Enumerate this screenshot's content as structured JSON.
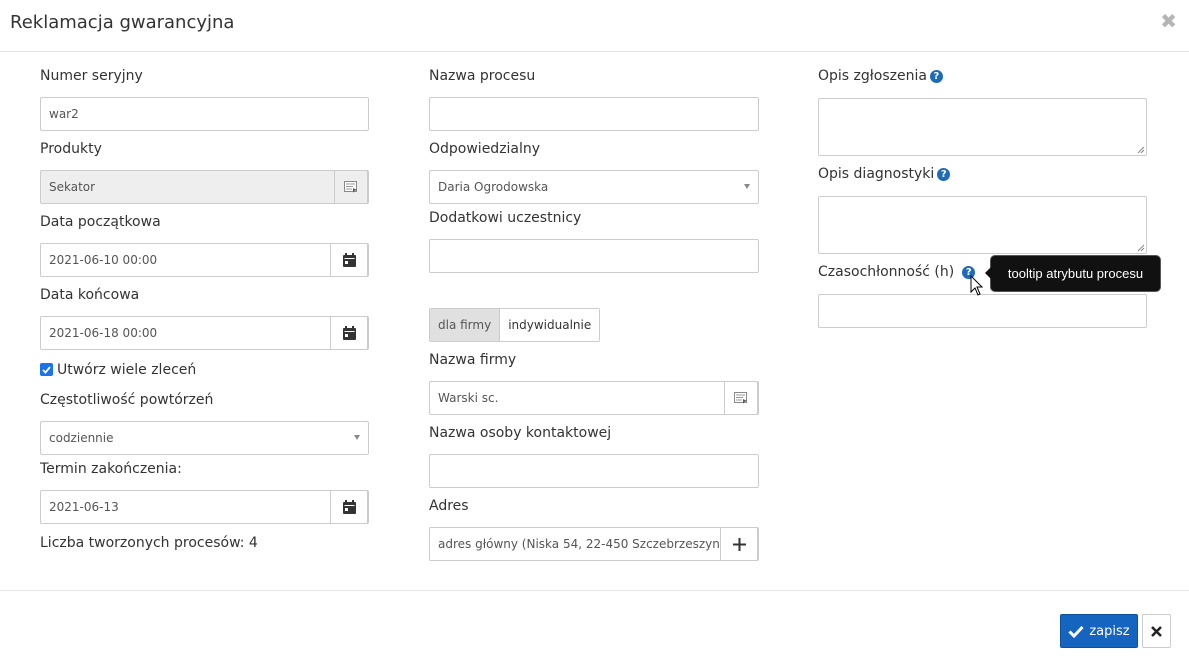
{
  "dialog": {
    "title": "Reklamacja gwarancyjna"
  },
  "col1": {
    "serial_label": "Numer seryjny",
    "serial_value": "war2",
    "products_label": "Produkty",
    "products_value": "Sekator",
    "start_date_label": "Data początkowa",
    "start_date_value": "2021-06-10 00:00",
    "end_date_label": "Data końcowa",
    "end_date_value": "2021-06-18 00:00",
    "multi_orders_label": "Utwórz wiele zleceń",
    "multi_orders_checked": true,
    "frequency_label": "Częstotliwość powtórzeń",
    "frequency_value": "codziennie",
    "end_term_label": "Termin zakończenia:",
    "end_term_value": "2021-06-13",
    "count_text": "Liczba tworzonych procesów: 4"
  },
  "col2": {
    "process_name_label": "Nazwa procesu",
    "process_name_value": "",
    "responsible_label": "Odpowiedzialny",
    "responsible_value": "Daria Ogrodowska",
    "participants_label": "Dodatkowi uczestnicy",
    "participants_value": "",
    "toggle": {
      "company": "dla firmy",
      "individual": "indywidualnie",
      "active": "company"
    },
    "company_name_label": "Nazwa firmy",
    "company_name_value": "Warski sc.",
    "contact_label": "Nazwa osoby kontaktowej",
    "contact_value": "",
    "address_label": "Adres",
    "address_value": "adres główny (Niska 54, 22-450 Szczebrzeszyn,"
  },
  "col3": {
    "report_desc_label": "Opis zgłoszenia",
    "diag_desc_label": "Opis diagnostyki",
    "time_label": "Czasochłonność (h)",
    "time_value": "",
    "tooltip_text": "tooltip atrybutu procesu"
  },
  "footer": {
    "save_label": "zapisz"
  },
  "colors": {
    "primary": "#1565c0",
    "help": "#1e6bb8",
    "checkbox": "#1a73e8"
  },
  "icons": [
    "calendar-icon",
    "list-picker-icon",
    "plus-icon",
    "help-icon",
    "check-icon",
    "close-icon",
    "caret-down-icon",
    "cursor-icon"
  ]
}
